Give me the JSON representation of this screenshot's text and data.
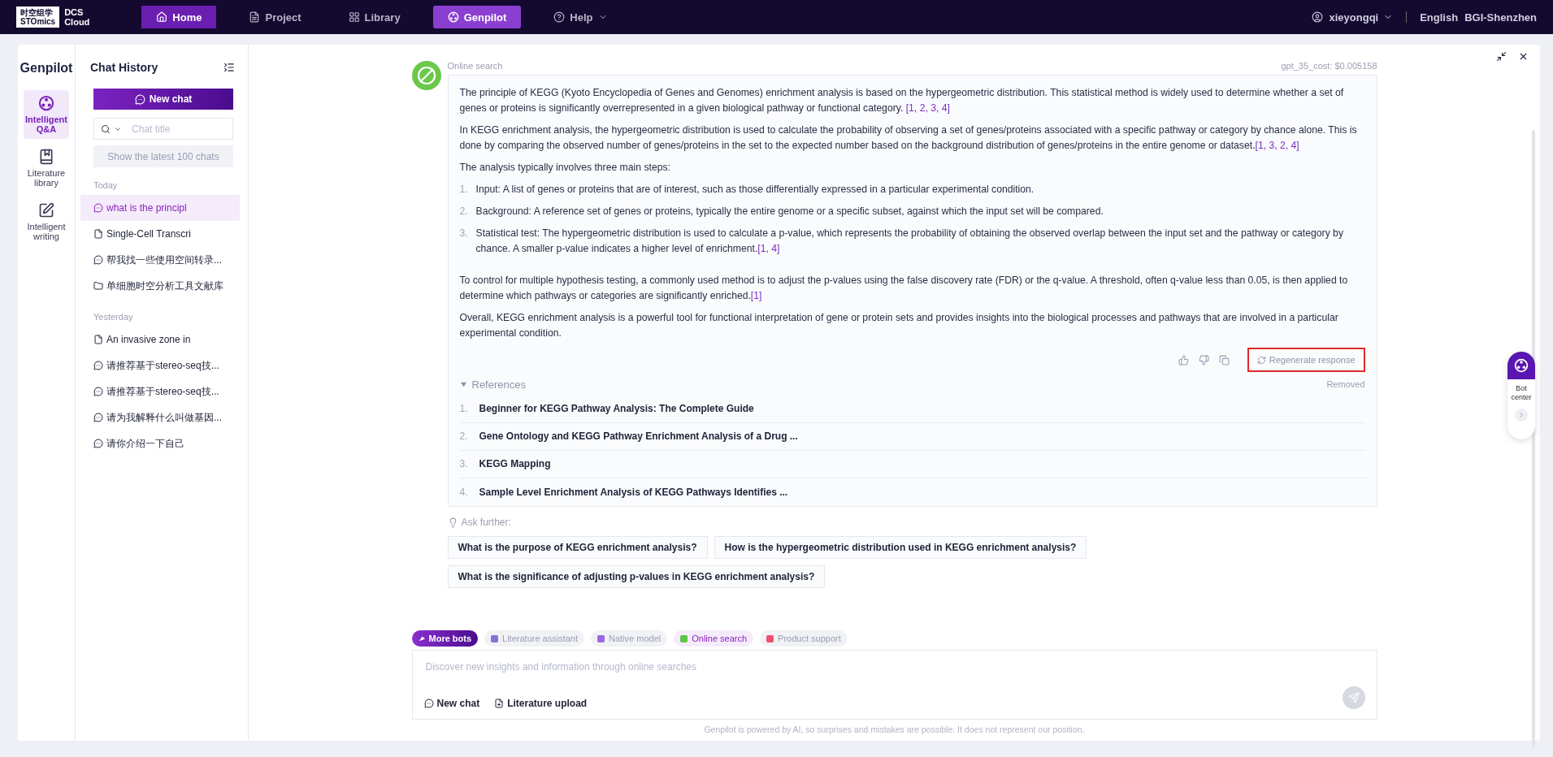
{
  "top_bar": {
    "logo_cn": "时空组学",
    "logo_en": "STOmics",
    "product": "DCS",
    "product2": "Cloud",
    "nav": [
      {
        "label": "Home",
        "kind": "home",
        "selected": true
      },
      {
        "label": "Project",
        "kind": "project",
        "selected": false
      },
      {
        "label": "Library",
        "kind": "library",
        "selected": false
      },
      {
        "label": "Genpilot",
        "kind": "genpilot",
        "selected": true
      },
      {
        "label": "Help",
        "kind": "help",
        "selected": false
      }
    ],
    "user": "xieyongqi",
    "language": "English",
    "region": "BGI-Shenzhen"
  },
  "rail": {
    "title": "Genpilot",
    "items": [
      {
        "label": "Intelligent Q&A",
        "kind": "qa",
        "selected": true
      },
      {
        "label": "Literature library",
        "kind": "library",
        "selected": false
      },
      {
        "label": "Intelligent writing",
        "kind": "writing",
        "selected": false
      }
    ]
  },
  "history": {
    "title": "Chat History",
    "new_chat": "New chat",
    "search_placeholder": "Chat title",
    "show_latest": "Show the latest 100 chats",
    "groups": [
      {
        "label": "Today",
        "items": [
          {
            "title": "what is the principl",
            "kind": "chat",
            "selected": true
          },
          {
            "title": "Single-Cell Transcri",
            "kind": "doc",
            "selected": false
          },
          {
            "title": "帮我找一些使用空间转录...",
            "kind": "chat",
            "selected": false
          },
          {
            "title": "单细胞时空分析工具文献库",
            "kind": "folder",
            "selected": false
          }
        ]
      },
      {
        "label": "Yesterday",
        "items": [
          {
            "title": "An invasive zone in",
            "kind": "doc",
            "selected": false
          },
          {
            "title": "请推荐基于stereo-seq技...",
            "kind": "chat",
            "selected": false
          },
          {
            "title": "请推荐基于stereo-seq技...",
            "kind": "chat",
            "selected": false
          },
          {
            "title": "请为我解释什么叫做基因...",
            "kind": "chat",
            "selected": false
          },
          {
            "title": "请你介绍一下自己",
            "kind": "chat",
            "selected": false
          }
        ]
      }
    ]
  },
  "message": {
    "source": "Online search",
    "cost": "gpt_35_cost: $0.005158",
    "paragraphs": [
      {
        "text": "The principle of KEGG (Kyoto Encyclopedia of Genes and Genomes) enrichment analysis is based on the hypergeometric distribution. This statistical method is widely used to determine whether a set of genes or proteins is significantly overrepresented in a given biological pathway or functional category. ",
        "cite": "[1, 2, 3, 4]"
      },
      {
        "text": "In KEGG enrichment analysis, the hypergeometric distribution is used to calculate the probability of observing a set of genes/proteins associated with a specific pathway or category by chance alone. This is done by comparing the observed number of genes/proteins in the set to the expected number based on the background distribution of genes/proteins in the entire genome or dataset.",
        "cite": "[1, 3, 2, 4]"
      },
      {
        "text": "The analysis typically involves three main steps:"
      }
    ],
    "steps": [
      {
        "number": "1.",
        "text": "Input: A list of genes or proteins that are of interest, such as those differentially expressed in a particular experimental condition."
      },
      {
        "number": "2.",
        "text": "Background: A reference set of genes or proteins, typically the entire genome or a specific subset, against which the input set will be compared."
      },
      {
        "number": "3.",
        "text": "Statistical test: The hypergeometric distribution is used to calculate a p-value, which represents the probability of obtaining the observed overlap between the input set and the pathway or category by chance. A smaller p-value indicates a higher level of enrichment.",
        "cite": "[1, 4]"
      }
    ],
    "closing": [
      {
        "text": "To control for multiple hypothesis testing, a commonly used method is to adjust the p-values using the false discovery rate (FDR) or the q-value. A threshold, often q-value less than 0.05, is then applied to determine which pathways or categories are significantly enriched.",
        "cite": "[1]"
      },
      {
        "text": "Overall, KEGG enrichment analysis is a powerful tool for functional interpretation of gene or protein sets and provides insights into the biological processes and pathways that are involved in a particular experimental condition."
      }
    ],
    "regenerate": "Regenerate response",
    "references": {
      "title": "References",
      "expanded": true,
      "status": "Removed",
      "items": [
        {
          "number": "1.",
          "title": "Beginner for KEGG Pathway Analysis: The Complete Guide"
        },
        {
          "number": "2.",
          "title": "Gene Ontology and KEGG Pathway Enrichment Analysis of a Drug ..."
        },
        {
          "number": "3.",
          "title": "KEGG Mapping"
        },
        {
          "number": "4.",
          "title": "Sample Level Enrichment Analysis of KEGG Pathways Identifies ..."
        }
      ]
    }
  },
  "ask_further": {
    "label": "Ask further:",
    "questions": [
      "What is the purpose of KEGG enrichment analysis?",
      "How is the hypergeometric distribution used in KEGG enrichment analysis?",
      "What is the significance of adjusting p-values in KEGG enrichment analysis?"
    ]
  },
  "bots": {
    "more": "More bots",
    "items": [
      {
        "label": "Literature assistant",
        "color": "#8b6fd6",
        "selected": false
      },
      {
        "label": "Native model",
        "color": "#9a6ae0",
        "selected": false
      },
      {
        "label": "Online search",
        "color": "#5cc645",
        "selected": true
      },
      {
        "label": "Product support",
        "color": "#f0506e",
        "selected": false
      }
    ]
  },
  "composer": {
    "placeholder": "Discover new insights and information through online searches",
    "new_chat": "New chat",
    "upload": "Literature upload"
  },
  "disclaimer": "Genpilot is powered by AI, so surprises and mistakes are possible. It does not represent our position.",
  "bot_center": {
    "label": "Bot center"
  }
}
